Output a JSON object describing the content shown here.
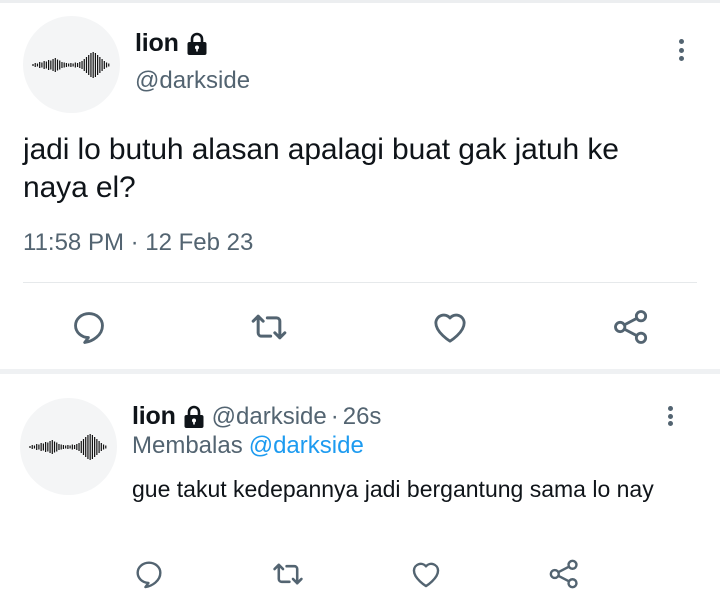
{
  "tweet": {
    "display_name": "lion",
    "handle": "@darkside",
    "text": "jadi lo butuh alasan apalagi buat gak jatuh ke naya el?",
    "timestamp": "11:58 PM · 12 Feb 23",
    "icons": [
      "lock-icon",
      "more-icon",
      "reply-icon",
      "retweet-icon",
      "like-icon",
      "share-icon"
    ]
  },
  "reply": {
    "display_name": "lion",
    "handle": "@darkside",
    "separator": "·",
    "time": "26s",
    "replying_to_label": "Membalas",
    "replying_to_handle": "@darkside",
    "text": "gue takut kedepannya jadi bergantung sama lo nay"
  },
  "colors": {
    "text": "#0f1419",
    "secondary": "#536471",
    "mention": "#1d9bf0",
    "icon": "#536471"
  }
}
